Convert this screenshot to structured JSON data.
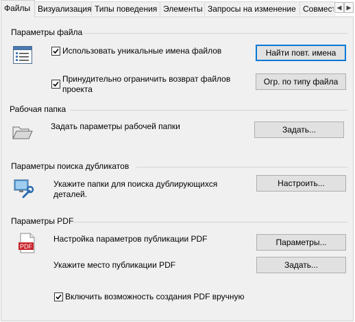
{
  "tabs": [
    {
      "label": "Файлы",
      "active": true
    },
    {
      "label": "Визуализация",
      "active": false
    },
    {
      "label": "Типы поведения",
      "active": false
    },
    {
      "label": "Элементы",
      "active": false
    },
    {
      "label": "Запросы на изменение",
      "active": false
    },
    {
      "label": "Совместная работа",
      "active": false
    }
  ],
  "file_params": {
    "title": "Параметры файла",
    "unique_names_checkbox": {
      "label": "Использовать уникальные имена файлов",
      "checked": true
    },
    "find_dup_button": "Найти повт. имена",
    "restrict_return_checkbox": {
      "label": "Принудительно ограничить возврат файлов проекта",
      "checked": true
    },
    "restrict_by_type_button": "Огр. по типу файла",
    "icon": "list-settings-icon"
  },
  "work_folder": {
    "title": "Рабочая папка",
    "description": "Задать параметры рабочей папки",
    "set_button": "Задать...",
    "icon": "open-folder-icon"
  },
  "duplicate_search": {
    "title": "Параметры поиска дубликатов",
    "description": "Укажите папки для поиска дублирующихся деталей.",
    "configure_button": "Настроить...",
    "icon": "monitor-wrench-icon"
  },
  "pdf_params": {
    "title": "Параметры PDF",
    "publish_settings_label": "Настройка параметров публикации PDF",
    "params_button": "Параметры...",
    "publish_location_label": "Укажите место публикации PDF",
    "set_button": "Задать...",
    "manual_pdf_checkbox": {
      "label": "Включить возможность создания PDF вручную",
      "checked": true
    },
    "icon": "pdf-file-icon",
    "icon_text": "PDF"
  }
}
